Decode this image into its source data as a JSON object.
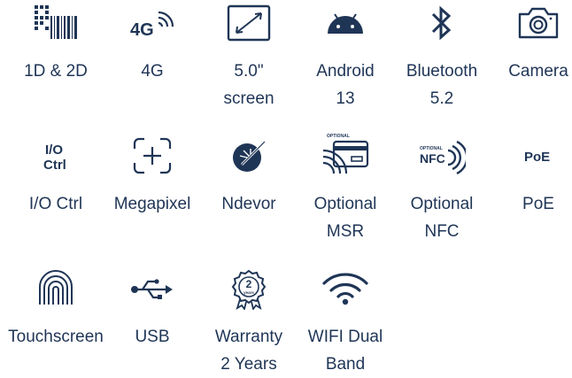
{
  "features": [
    {
      "icon": "barcode-icon",
      "lines": [
        "1D & 2D"
      ]
    },
    {
      "icon": "4g-signal-icon",
      "lines": [
        "4G"
      ],
      "icon_text": "4G"
    },
    {
      "icon": "screen-size-icon",
      "lines": [
        "5.0\"",
        "screen"
      ]
    },
    {
      "icon": "android-icon",
      "lines": [
        "Android",
        "13"
      ]
    },
    {
      "icon": "bluetooth-icon",
      "lines": [
        "Bluetooth",
        "5.2"
      ]
    },
    {
      "icon": "camera-icon",
      "lines": [
        "Camera"
      ]
    },
    {
      "icon": "io-ctrl-icon",
      "lines": [
        "I/O Ctrl"
      ],
      "icon_text": [
        "I/O",
        "Ctrl"
      ]
    },
    {
      "icon": "megapixel-icon",
      "lines": [
        "Megapixel"
      ]
    },
    {
      "icon": "ndevor-icon",
      "lines": [
        "Ndevor"
      ]
    },
    {
      "icon": "msr-card-icon",
      "lines": [
        "Optional",
        "MSR"
      ],
      "icon_text": "OPTIONAL"
    },
    {
      "icon": "nfc-icon",
      "lines": [
        "Optional",
        "NFC"
      ],
      "icon_text": [
        "OPTIONAL",
        "NFC"
      ]
    },
    {
      "icon": "poe-icon",
      "lines": [
        "PoE"
      ],
      "icon_text": "PoE"
    },
    {
      "icon": "fingerprint-touch-icon",
      "lines": [
        "Touchscreen"
      ]
    },
    {
      "icon": "usb-icon",
      "lines": [
        "USB"
      ]
    },
    {
      "icon": "warranty-badge-icon",
      "lines": [
        "Warranty",
        "2 Years"
      ],
      "icon_text": [
        "2",
        "years"
      ]
    },
    {
      "icon": "wifi-icon",
      "lines": [
        "WIFI Dual",
        "Band"
      ]
    }
  ],
  "colors": {
    "icon": "#1f3556",
    "text": "#1f3556",
    "background": "#ffffff"
  }
}
